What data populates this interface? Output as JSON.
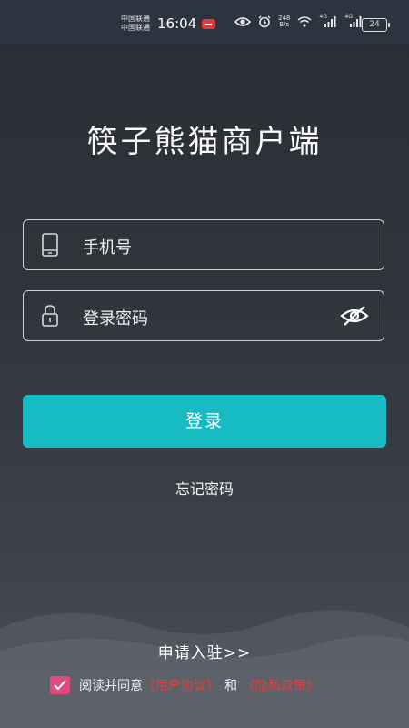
{
  "status_bar": {
    "carrier_1": "中国联通",
    "carrier_2": "中国联通",
    "time": "16:04",
    "speed_value": "248",
    "speed_unit": "B/s",
    "network_1": "4G",
    "network_2": "4G",
    "battery": "24"
  },
  "title": "筷子熊猫商户端",
  "phone": {
    "placeholder": "手机号",
    "icon": "phone-icon"
  },
  "password": {
    "placeholder": "登录密码",
    "icon": "lock-icon",
    "toggle_icon": "eye-hidden-icon"
  },
  "login_button": "登录",
  "forgot_password": "忘记密码",
  "apply": "申请入驻>>",
  "agreement": {
    "checked": true,
    "prefix": "阅读并同意",
    "user_agreement": "《用户协议》",
    "and": "和",
    "privacy_policy": "《隐私政策》"
  },
  "colors": {
    "accent": "#17bcc3",
    "link": "#e0403f",
    "checkbox": "#e3497f"
  }
}
